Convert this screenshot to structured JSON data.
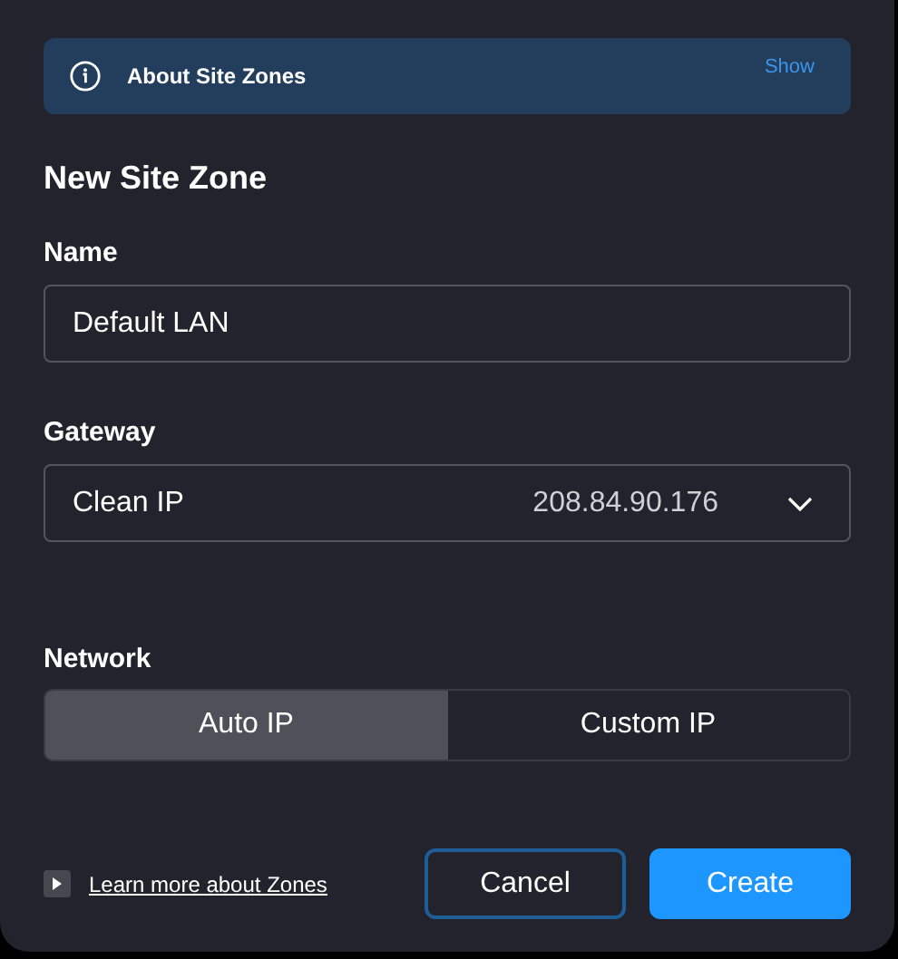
{
  "banner": {
    "title": "About Site Zones",
    "action": "Show"
  },
  "heading": "New Site Zone",
  "name_field": {
    "label": "Name",
    "value": "Default LAN"
  },
  "gateway": {
    "label": "Gateway",
    "value": "Clean IP",
    "address": "208.84.90.176"
  },
  "network": {
    "label": "Network",
    "options": [
      {
        "label": "Auto IP",
        "selected": true
      },
      {
        "label": "Custom IP",
        "selected": false
      }
    ]
  },
  "learn_link": "Learn more about Zones",
  "buttons": [
    {
      "label": "Cancel",
      "kind": "secondary"
    },
    {
      "label": "Create",
      "kind": "primary"
    }
  ]
}
